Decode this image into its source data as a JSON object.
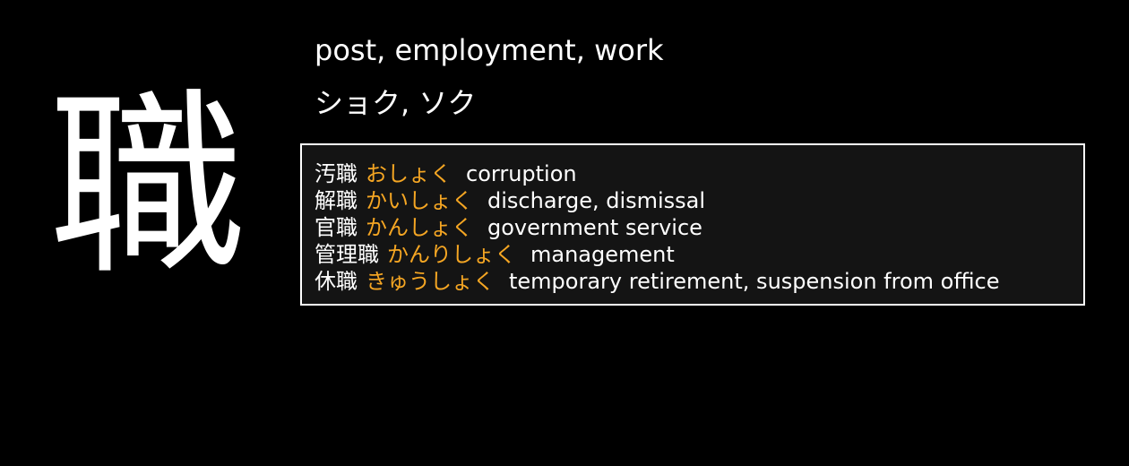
{
  "kanji": {
    "character": "職"
  },
  "meaning": "post, employment, work",
  "readings": "ショク, ソク",
  "vocabulary": [
    {
      "word": "汚職",
      "reading": "おしょく",
      "gloss": "corruption"
    },
    {
      "word": "解職",
      "reading": "かいしょく",
      "gloss": "discharge, dismissal"
    },
    {
      "word": "官職",
      "reading": "かんしょく",
      "gloss": "government service"
    },
    {
      "word": "管理職",
      "reading": "かんりしょく",
      "gloss": "management"
    },
    {
      "word": "休職",
      "reading": "きゅうしょく",
      "gloss": "temporary retirement, suspension from office"
    }
  ],
  "colors": {
    "background": "#000000",
    "text": "#ffffff",
    "kana_accent": "#f5a623",
    "box_background": "#141414",
    "box_border": "#ffffff"
  }
}
